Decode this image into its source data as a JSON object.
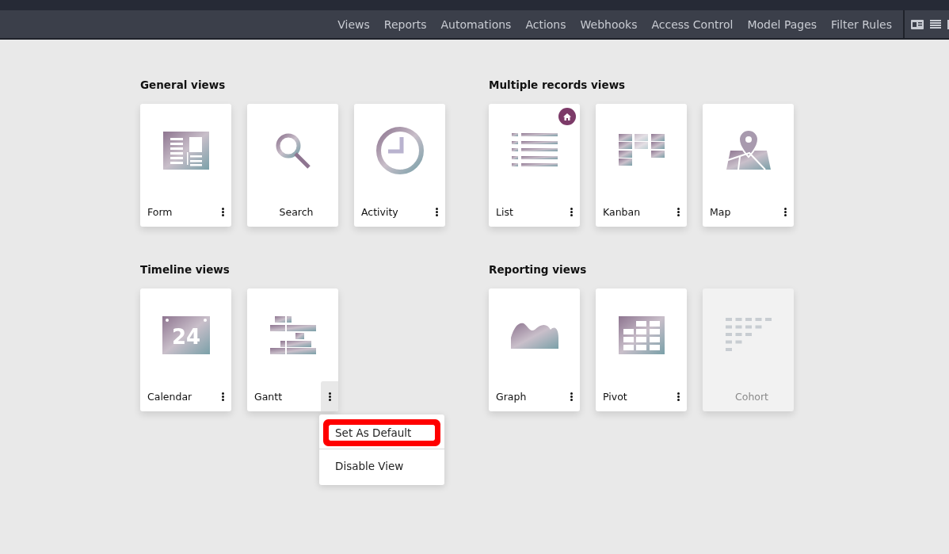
{
  "nav": {
    "items": [
      "Views",
      "Reports",
      "Automations",
      "Actions",
      "Webhooks",
      "Access Control",
      "Model Pages",
      "Filter Rules"
    ]
  },
  "sections": [
    {
      "title": "General views",
      "cards": [
        {
          "kind": "form",
          "label": "Form",
          "has_menu": true,
          "is_default": false,
          "disabled": false,
          "menu_open": false
        },
        {
          "kind": "search",
          "label": "Search",
          "has_menu": false,
          "is_default": false,
          "disabled": false,
          "menu_open": false
        },
        {
          "kind": "activity",
          "label": "Activity",
          "has_menu": true,
          "is_default": false,
          "disabled": false,
          "menu_open": false
        }
      ]
    },
    {
      "title": "Multiple records views",
      "cards": [
        {
          "kind": "list",
          "label": "List",
          "has_menu": true,
          "is_default": true,
          "disabled": false,
          "menu_open": false
        },
        {
          "kind": "kanban",
          "label": "Kanban",
          "has_menu": true,
          "is_default": false,
          "disabled": false,
          "menu_open": false
        },
        {
          "kind": "map",
          "label": "Map",
          "has_menu": true,
          "is_default": false,
          "disabled": false,
          "menu_open": false
        }
      ]
    },
    {
      "title": "Timeline views",
      "cards": [
        {
          "kind": "calendar",
          "label": "Calendar",
          "icon_text": "24",
          "has_menu": true,
          "is_default": false,
          "disabled": false,
          "menu_open": false
        },
        {
          "kind": "gantt",
          "label": "Gantt",
          "has_menu": true,
          "is_default": false,
          "disabled": false,
          "menu_open": true
        }
      ]
    },
    {
      "title": "Reporting views",
      "cards": [
        {
          "kind": "graph",
          "label": "Graph",
          "has_menu": true,
          "is_default": false,
          "disabled": false,
          "menu_open": false
        },
        {
          "kind": "pivot",
          "label": "Pivot",
          "has_menu": true,
          "is_default": false,
          "disabled": false,
          "menu_open": false
        },
        {
          "kind": "cohort",
          "label": "Cohort",
          "has_menu": false,
          "is_default": false,
          "disabled": true,
          "menu_open": false
        }
      ]
    }
  ],
  "menu": {
    "items": [
      {
        "label": "Set As Default",
        "highlighted": true
      },
      {
        "label": "Disable View",
        "highlighted": false
      }
    ]
  }
}
